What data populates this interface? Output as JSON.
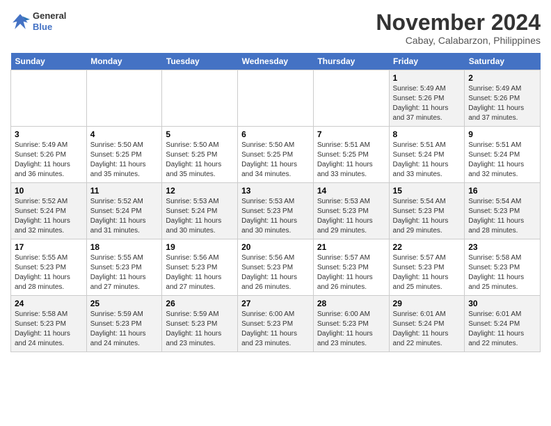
{
  "header": {
    "logo_line1": "General",
    "logo_line2": "Blue",
    "month": "November 2024",
    "location": "Cabay, Calabarzon, Philippines"
  },
  "weekdays": [
    "Sunday",
    "Monday",
    "Tuesday",
    "Wednesday",
    "Thursday",
    "Friday",
    "Saturday"
  ],
  "weeks": [
    [
      {
        "day": "",
        "info": ""
      },
      {
        "day": "",
        "info": ""
      },
      {
        "day": "",
        "info": ""
      },
      {
        "day": "",
        "info": ""
      },
      {
        "day": "",
        "info": ""
      },
      {
        "day": "1",
        "info": "Sunrise: 5:49 AM\nSunset: 5:26 PM\nDaylight: 11 hours and 37 minutes."
      },
      {
        "day": "2",
        "info": "Sunrise: 5:49 AM\nSunset: 5:26 PM\nDaylight: 11 hours and 37 minutes."
      }
    ],
    [
      {
        "day": "3",
        "info": "Sunrise: 5:49 AM\nSunset: 5:26 PM\nDaylight: 11 hours and 36 minutes."
      },
      {
        "day": "4",
        "info": "Sunrise: 5:50 AM\nSunset: 5:25 PM\nDaylight: 11 hours and 35 minutes."
      },
      {
        "day": "5",
        "info": "Sunrise: 5:50 AM\nSunset: 5:25 PM\nDaylight: 11 hours and 35 minutes."
      },
      {
        "day": "6",
        "info": "Sunrise: 5:50 AM\nSunset: 5:25 PM\nDaylight: 11 hours and 34 minutes."
      },
      {
        "day": "7",
        "info": "Sunrise: 5:51 AM\nSunset: 5:25 PM\nDaylight: 11 hours and 33 minutes."
      },
      {
        "day": "8",
        "info": "Sunrise: 5:51 AM\nSunset: 5:24 PM\nDaylight: 11 hours and 33 minutes."
      },
      {
        "day": "9",
        "info": "Sunrise: 5:51 AM\nSunset: 5:24 PM\nDaylight: 11 hours and 32 minutes."
      }
    ],
    [
      {
        "day": "10",
        "info": "Sunrise: 5:52 AM\nSunset: 5:24 PM\nDaylight: 11 hours and 32 minutes."
      },
      {
        "day": "11",
        "info": "Sunrise: 5:52 AM\nSunset: 5:24 PM\nDaylight: 11 hours and 31 minutes."
      },
      {
        "day": "12",
        "info": "Sunrise: 5:53 AM\nSunset: 5:24 PM\nDaylight: 11 hours and 30 minutes."
      },
      {
        "day": "13",
        "info": "Sunrise: 5:53 AM\nSunset: 5:23 PM\nDaylight: 11 hours and 30 minutes."
      },
      {
        "day": "14",
        "info": "Sunrise: 5:53 AM\nSunset: 5:23 PM\nDaylight: 11 hours and 29 minutes."
      },
      {
        "day": "15",
        "info": "Sunrise: 5:54 AM\nSunset: 5:23 PM\nDaylight: 11 hours and 29 minutes."
      },
      {
        "day": "16",
        "info": "Sunrise: 5:54 AM\nSunset: 5:23 PM\nDaylight: 11 hours and 28 minutes."
      }
    ],
    [
      {
        "day": "17",
        "info": "Sunrise: 5:55 AM\nSunset: 5:23 PM\nDaylight: 11 hours and 28 minutes."
      },
      {
        "day": "18",
        "info": "Sunrise: 5:55 AM\nSunset: 5:23 PM\nDaylight: 11 hours and 27 minutes."
      },
      {
        "day": "19",
        "info": "Sunrise: 5:56 AM\nSunset: 5:23 PM\nDaylight: 11 hours and 27 minutes."
      },
      {
        "day": "20",
        "info": "Sunrise: 5:56 AM\nSunset: 5:23 PM\nDaylight: 11 hours and 26 minutes."
      },
      {
        "day": "21",
        "info": "Sunrise: 5:57 AM\nSunset: 5:23 PM\nDaylight: 11 hours and 26 minutes."
      },
      {
        "day": "22",
        "info": "Sunrise: 5:57 AM\nSunset: 5:23 PM\nDaylight: 11 hours and 25 minutes."
      },
      {
        "day": "23",
        "info": "Sunrise: 5:58 AM\nSunset: 5:23 PM\nDaylight: 11 hours and 25 minutes."
      }
    ],
    [
      {
        "day": "24",
        "info": "Sunrise: 5:58 AM\nSunset: 5:23 PM\nDaylight: 11 hours and 24 minutes."
      },
      {
        "day": "25",
        "info": "Sunrise: 5:59 AM\nSunset: 5:23 PM\nDaylight: 11 hours and 24 minutes."
      },
      {
        "day": "26",
        "info": "Sunrise: 5:59 AM\nSunset: 5:23 PM\nDaylight: 11 hours and 23 minutes."
      },
      {
        "day": "27",
        "info": "Sunrise: 6:00 AM\nSunset: 5:23 PM\nDaylight: 11 hours and 23 minutes."
      },
      {
        "day": "28",
        "info": "Sunrise: 6:00 AM\nSunset: 5:23 PM\nDaylight: 11 hours and 23 minutes."
      },
      {
        "day": "29",
        "info": "Sunrise: 6:01 AM\nSunset: 5:24 PM\nDaylight: 11 hours and 22 minutes."
      },
      {
        "day": "30",
        "info": "Sunrise: 6:01 AM\nSunset: 5:24 PM\nDaylight: 11 hours and 22 minutes."
      }
    ]
  ]
}
